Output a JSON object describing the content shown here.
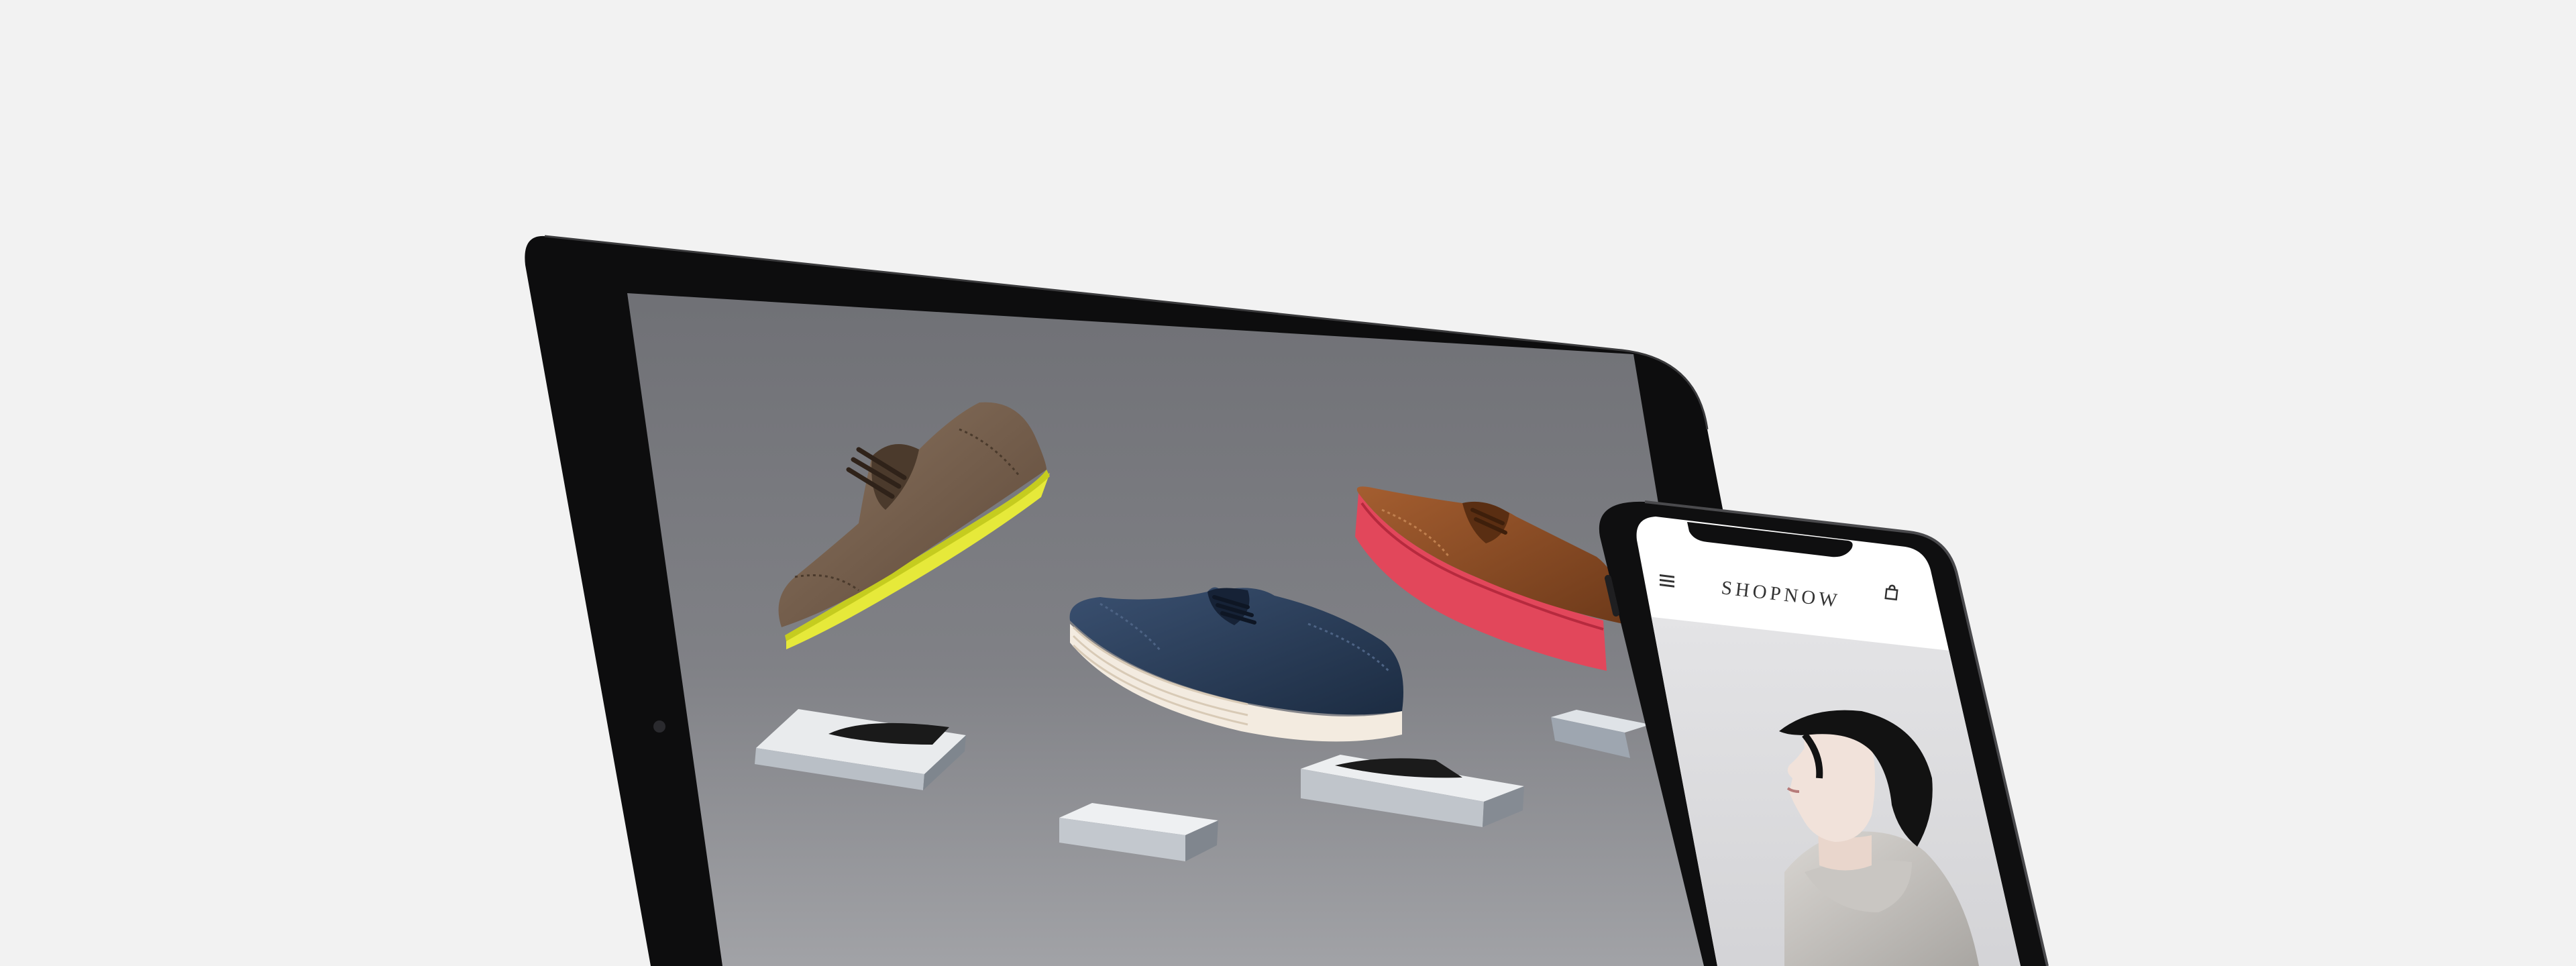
{
  "phone": {
    "brand": "SHOPNOW",
    "menu_icon": "hamburger-menu-icon",
    "bag_icon": "shopping-bag-icon"
  },
  "colors": {
    "background": "#f2f2f2",
    "device_frame": "#0d0d0e",
    "tablet_screen": "#76777c",
    "shoe_brown": "#6e5846",
    "shoe_brown_sole": "#dfe82a",
    "shoe_navy": "#273a55",
    "shoe_navy_sole": "#f0e7da",
    "shoe_tan": "#8a4c25",
    "shoe_tan_sole": "#e0465a"
  }
}
